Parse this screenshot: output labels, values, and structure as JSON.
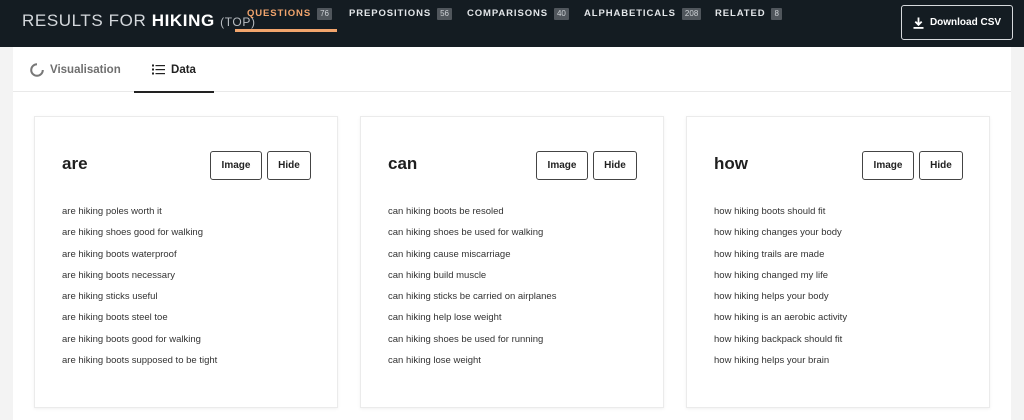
{
  "header": {
    "title_prefix": "RESULTS FOR",
    "keyword": "HIKING",
    "subtitle": "(TOP)",
    "download_label": "Download CSV"
  },
  "nav_tabs": [
    {
      "label": "QUESTIONS",
      "count": "76",
      "active": true
    },
    {
      "label": "PREPOSITIONS",
      "count": "56",
      "active": false
    },
    {
      "label": "COMPARISONS",
      "count": "40",
      "active": false
    },
    {
      "label": "ALPHABETICALS",
      "count": "208",
      "active": false
    },
    {
      "label": "RELATED",
      "count": "8",
      "active": false
    }
  ],
  "view_tabs": {
    "visualisation": "Visualisation",
    "data": "Data",
    "active": "data"
  },
  "colors": {
    "topbar": "#141c22",
    "accent": "#f2a56d",
    "background": "#f3f3f3"
  },
  "cards": [
    {
      "title": "are",
      "image_label": "Image",
      "hide_label": "Hide",
      "items": [
        "are hiking poles worth it",
        "are hiking shoes good for walking",
        "are hiking boots waterproof",
        "are hiking boots necessary",
        "are hiking sticks useful",
        "are hiking boots steel toe",
        "are hiking boots good for walking",
        "are hiking boots supposed to be tight"
      ]
    },
    {
      "title": "can",
      "image_label": "Image",
      "hide_label": "Hide",
      "items": [
        "can hiking boots be resoled",
        "can hiking shoes be used for walking",
        "can hiking cause miscarriage",
        "can hiking build muscle",
        "can hiking sticks be carried on airplanes",
        "can hiking help lose weight",
        "can hiking shoes be used for running",
        "can hiking lose weight"
      ]
    },
    {
      "title": "how",
      "image_label": "Image",
      "hide_label": "Hide",
      "items": [
        "how hiking boots should fit",
        "how hiking changes your body",
        "how hiking trails are made",
        "how hiking changed my life",
        "how hiking helps your body",
        "how hiking is an aerobic activity",
        "how hiking backpack should fit",
        "how hiking helps your brain"
      ]
    }
  ]
}
